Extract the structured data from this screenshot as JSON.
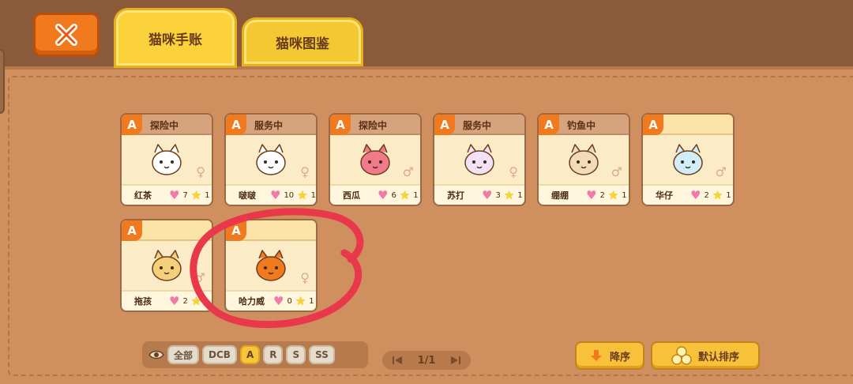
{
  "tabs": [
    {
      "label": "猫咪手账",
      "active": true
    },
    {
      "label": "猫咪图鉴",
      "active": false
    }
  ],
  "cards": [
    {
      "rank": "A",
      "status": "探险中",
      "name": "红茶",
      "hearts": "7",
      "stars": "1",
      "gender": "female",
      "face_color": "#ffffff",
      "face_icon": "fluffy-cat-icon"
    },
    {
      "rank": "A",
      "status": "服务中",
      "name": "啵啵",
      "hearts": "10",
      "stars": "1",
      "gender": "female",
      "face_color": "#ffffff",
      "face_icon": "white-cat-icon"
    },
    {
      "rank": "A",
      "status": "探险中",
      "name": "西瓜",
      "hearts": "6",
      "stars": "1",
      "gender": "male",
      "face_color": "#f17a8a",
      "face_icon": "watermelon-cat-icon"
    },
    {
      "rank": "A",
      "status": "服务中",
      "name": "苏打",
      "hearts": "3",
      "stars": "1",
      "gender": "female",
      "face_color": "#f3e2f7",
      "face_icon": "pastel-cat-icon"
    },
    {
      "rank": "A",
      "status": "钓鱼中",
      "name": "绷绷",
      "hearts": "2",
      "stars": "1",
      "gender": "male",
      "face_color": "#f2dcb7",
      "face_icon": "mummy-cat-icon"
    },
    {
      "rank": "A",
      "status": "",
      "name": "华仔",
      "hearts": "2",
      "stars": "1",
      "gender": "male",
      "face_color": "#cfeef7",
      "face_icon": "blue-cat-icon"
    },
    {
      "rank": "A",
      "status": "",
      "name": "拖孩",
      "hearts": "2",
      "stars": "",
      "gender": "male",
      "face_color": "#f4d07a",
      "face_icon": "peanut-cat-icon"
    },
    {
      "rank": "A",
      "status": "",
      "name": "哈力威",
      "hearts": "0",
      "stars": "1",
      "gender": "female",
      "face_color": "#f07a1d",
      "face_icon": "pumpkin-cat-icon"
    }
  ],
  "filters": {
    "chips": [
      "全部",
      "DCB",
      "A",
      "R",
      "S",
      "SS"
    ],
    "active": "A"
  },
  "pager": {
    "label": "1/1"
  },
  "sort": {
    "desc_label": "降序",
    "default_label": "默认排序"
  },
  "colors": {
    "accent": "#f07a1d",
    "tab_yellow": "#fbd23a",
    "annotation_red": "#e8384a"
  }
}
